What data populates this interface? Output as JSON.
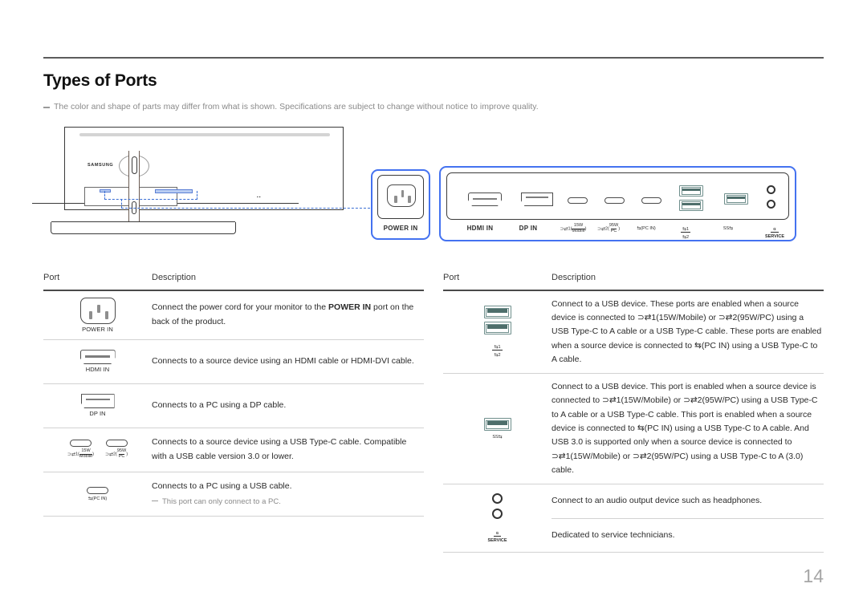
{
  "document": {
    "title": "Types of Ports",
    "top_note": "The color and shape of parts may differ from what is shown. Specifications are subject to change without notice to improve quality.",
    "page_number": "14"
  },
  "colors": {
    "callout_blue": "#4472f0",
    "dashed_blue": "#3b6fd4",
    "highlight_blue": "#b9cdf2",
    "usb_teal": "#4e6e6b",
    "rule_dark": "#4a4a4a",
    "muted_text": "#8a8a8a"
  },
  "diagram": {
    "monitor_brand": "SAMSUNG",
    "power_callout": {
      "label": "POWER IN",
      "icon": "iec-power-connector-icon"
    },
    "ports_callout": {
      "ports": [
        {
          "icon": "hdmi-port-icon",
          "label": "HDMI IN"
        },
        {
          "icon": "displayport-icon",
          "label": "DP IN"
        },
        {
          "icon": "usb-type-c-icon",
          "label": "1",
          "num": "15W",
          "den": "Mobile"
        },
        {
          "icon": "usb-type-c-icon",
          "label": "2",
          "num": "95W",
          "den": "PC"
        },
        {
          "icon": "usb-type-c-icon",
          "label": "(PC IN)"
        },
        {
          "icon": "usb-a-double-icon",
          "label_top": "1",
          "label_bottom": "2"
        },
        {
          "icon": "usb-a-superspeed-icon",
          "label": "SS"
        },
        {
          "icon": "headphone-service-icon",
          "label_top": "headphone",
          "label_bottom": "SERVICE"
        }
      ]
    }
  },
  "table_left": {
    "headers": {
      "port": "Port",
      "description": "Description"
    },
    "rows": [
      {
        "icon": "iec-power-connector-icon",
        "caption": "POWER IN",
        "description_pre": "Connect the power cord for your monitor to the ",
        "description_bold": "POWER IN",
        "description_post": " port on the back of the product."
      },
      {
        "icon": "hdmi-port-icon",
        "caption": "HDMI IN",
        "description": "Connects to a source device using an HDMI cable or HDMI-DVI cable."
      },
      {
        "icon": "displayport-icon",
        "caption": "DP IN",
        "description": "Connects to a PC using a DP cable."
      },
      {
        "icon": "usb-type-c-pair-icon",
        "caption_1_num": "15W",
        "caption_1_den": "Mobile",
        "caption_1_index": "1",
        "caption_2_num": "95W",
        "caption_2_den": "PC",
        "caption_2_index": "2",
        "description": "Connects to a source device using a USB Type-C cable. Compatible with a USB cable version 3.0 or lower."
      },
      {
        "icon": "usb-type-c-icon",
        "caption": "(PC IN)",
        "description": "Connects to a PC using a USB cable.",
        "sub_note": "This port can only connect to a PC."
      }
    ]
  },
  "table_right": {
    "headers": {
      "port": "Port",
      "description": "Description"
    },
    "rows": [
      {
        "icon": "usb-a-double-icon",
        "caption_top": "1",
        "caption_bottom": "2",
        "description": "Connect to a USB device. These ports are enabled when a source device is connected to ⊃⇄1(15W/Mobile) or ⊃⇄2(95W/PC) using a USB Type-C to A cable or a USB Type-C cable. These ports are enabled when a source device is connected to ⇆(PC IN) using a USB Type-C to A cable."
      },
      {
        "icon": "usb-a-superspeed-icon",
        "caption": "SS",
        "description": "Connect to a USB device. This port is enabled when a source device is connected to ⊃⇄1(15W/Mobile) or ⊃⇄2(95W/PC) using a USB Type-C to A cable or a USB Type-C cable. This port is enabled when a source device is connected to ⇆(PC IN) using a USB Type-C to A cable. And USB 3.0 is supported only when a source device is connected to ⊃⇄1(15W/Mobile) or ⊃⇄2(95W/PC) using a USB Type-C to A (3.0) cable."
      },
      {
        "icon": "headphone-jack-icon",
        "description": "Connect to an audio output device such as headphones."
      },
      {
        "icon": "service-jack-icon",
        "caption": "SERVICE",
        "description": "Dedicated to service technicians."
      }
    ]
  }
}
